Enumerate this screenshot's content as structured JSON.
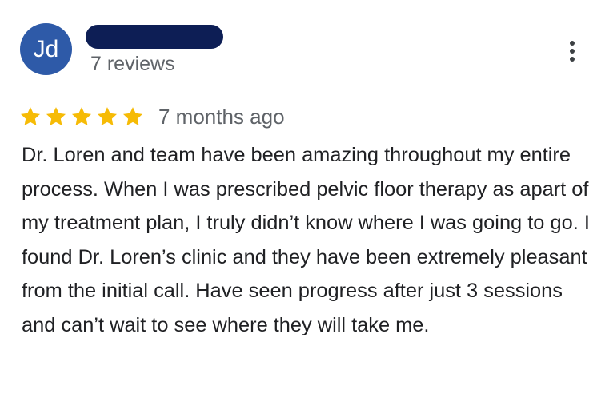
{
  "reviewer": {
    "initials": "Jd",
    "review_count": "7 reviews"
  },
  "review": {
    "rating": 5,
    "max_rating": 5,
    "time_ago": "7 months ago",
    "text": "Dr. Loren and team have been amazing throughout my entire process. When I was prescribed pelvic floor therapy as apart of my treatment plan, I truly didn’t know where I was going to go. I found Dr. Loren’s clinic and they have been extremely pleasant from the initial call. Have seen progress after just 3 sessions and can’t wait to see where they will take me."
  },
  "colors": {
    "avatar_bg": "#2e5aa8",
    "name_redaction": "#0d1e55",
    "star": "#f6bb06",
    "secondary_text": "#5f6368"
  },
  "icons": {
    "star": "star-icon",
    "more": "more-vert-icon"
  }
}
